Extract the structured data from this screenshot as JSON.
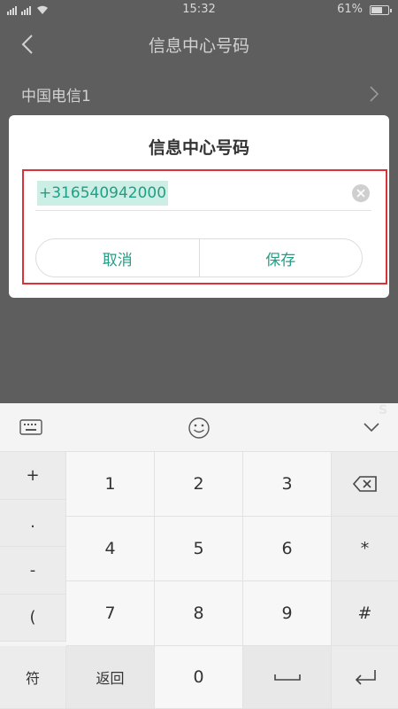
{
  "status_bar": {
    "signal_text": "📶ᴵᴵ 📶ᴵᴵ",
    "time": "15:32",
    "battery": "61%"
  },
  "nav": {
    "title": "信息中心号码"
  },
  "carrier": {
    "label": "中国电信1"
  },
  "dialog": {
    "title": "信息中心号码",
    "value": "+316540942000",
    "cancel_label": "取消",
    "save_label": "保存"
  },
  "keyboard": {
    "symbols": [
      "+",
      ".",
      "-",
      "("
    ],
    "digits": [
      "1",
      "2",
      "3",
      "4",
      "5",
      "6",
      "7",
      "8",
      "9"
    ],
    "star": "*",
    "hash": "#",
    "fu": "符",
    "back": "返回",
    "zero": "0",
    "sogou": "S"
  },
  "colors": {
    "accent": "#1f9f86",
    "highlight_border": "#d9323a",
    "dim_background": "#5e5e5e"
  }
}
